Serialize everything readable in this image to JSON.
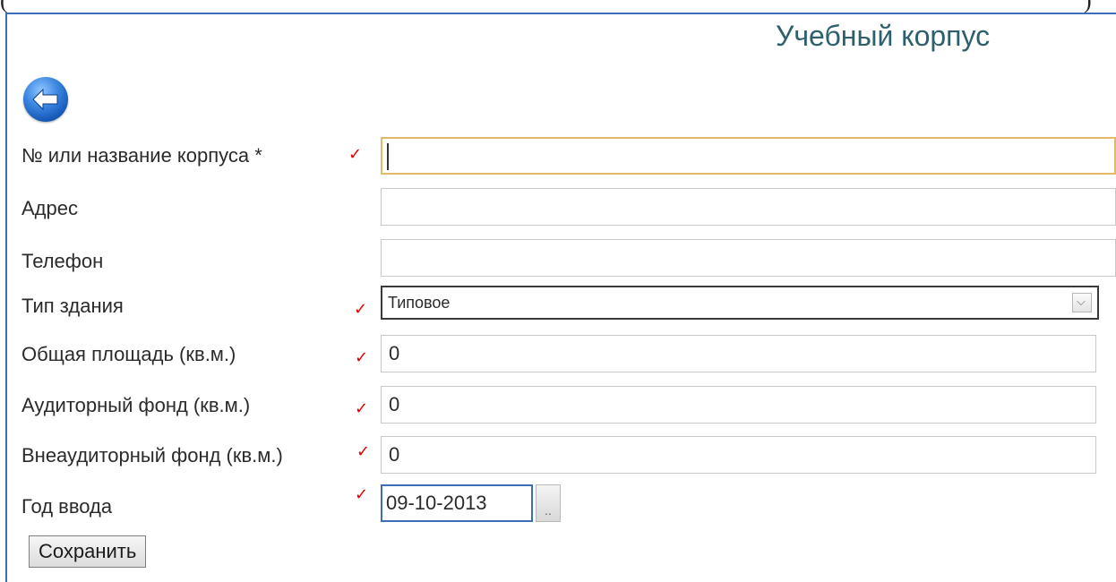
{
  "top_fragment": {
    "left": "(",
    "right": ")"
  },
  "page": {
    "title": "Учебный корпус"
  },
  "back_button": {
    "icon": "arrow-left-icon"
  },
  "form": {
    "required_mark": "✓",
    "fields": [
      {
        "label": "№ или название корпуса *",
        "value": "",
        "required": true
      },
      {
        "label": "Адрес",
        "value": "",
        "required": false
      },
      {
        "label": "Телефон",
        "value": "",
        "required": false
      },
      {
        "label": "Тип здания",
        "value": "Типовое",
        "required": true
      },
      {
        "label": "Общая площадь (кв.м.)",
        "value": "0",
        "required": true
      },
      {
        "label": "Аудиторный фонд (кв.м.)",
        "value": "0",
        "required": true
      },
      {
        "label": "Внеаудиторный фонд (кв.м.)",
        "value": "0",
        "required": true
      },
      {
        "label": "Год ввода",
        "value": "09-10-2013",
        "required": true
      }
    ],
    "date_button_label": "..",
    "save_label": "Сохранить"
  },
  "colors": {
    "title": "#2d5f6d",
    "frame": "#3a6fb6",
    "required_mark": "#e00000",
    "focus_border": "#e5b86a"
  }
}
